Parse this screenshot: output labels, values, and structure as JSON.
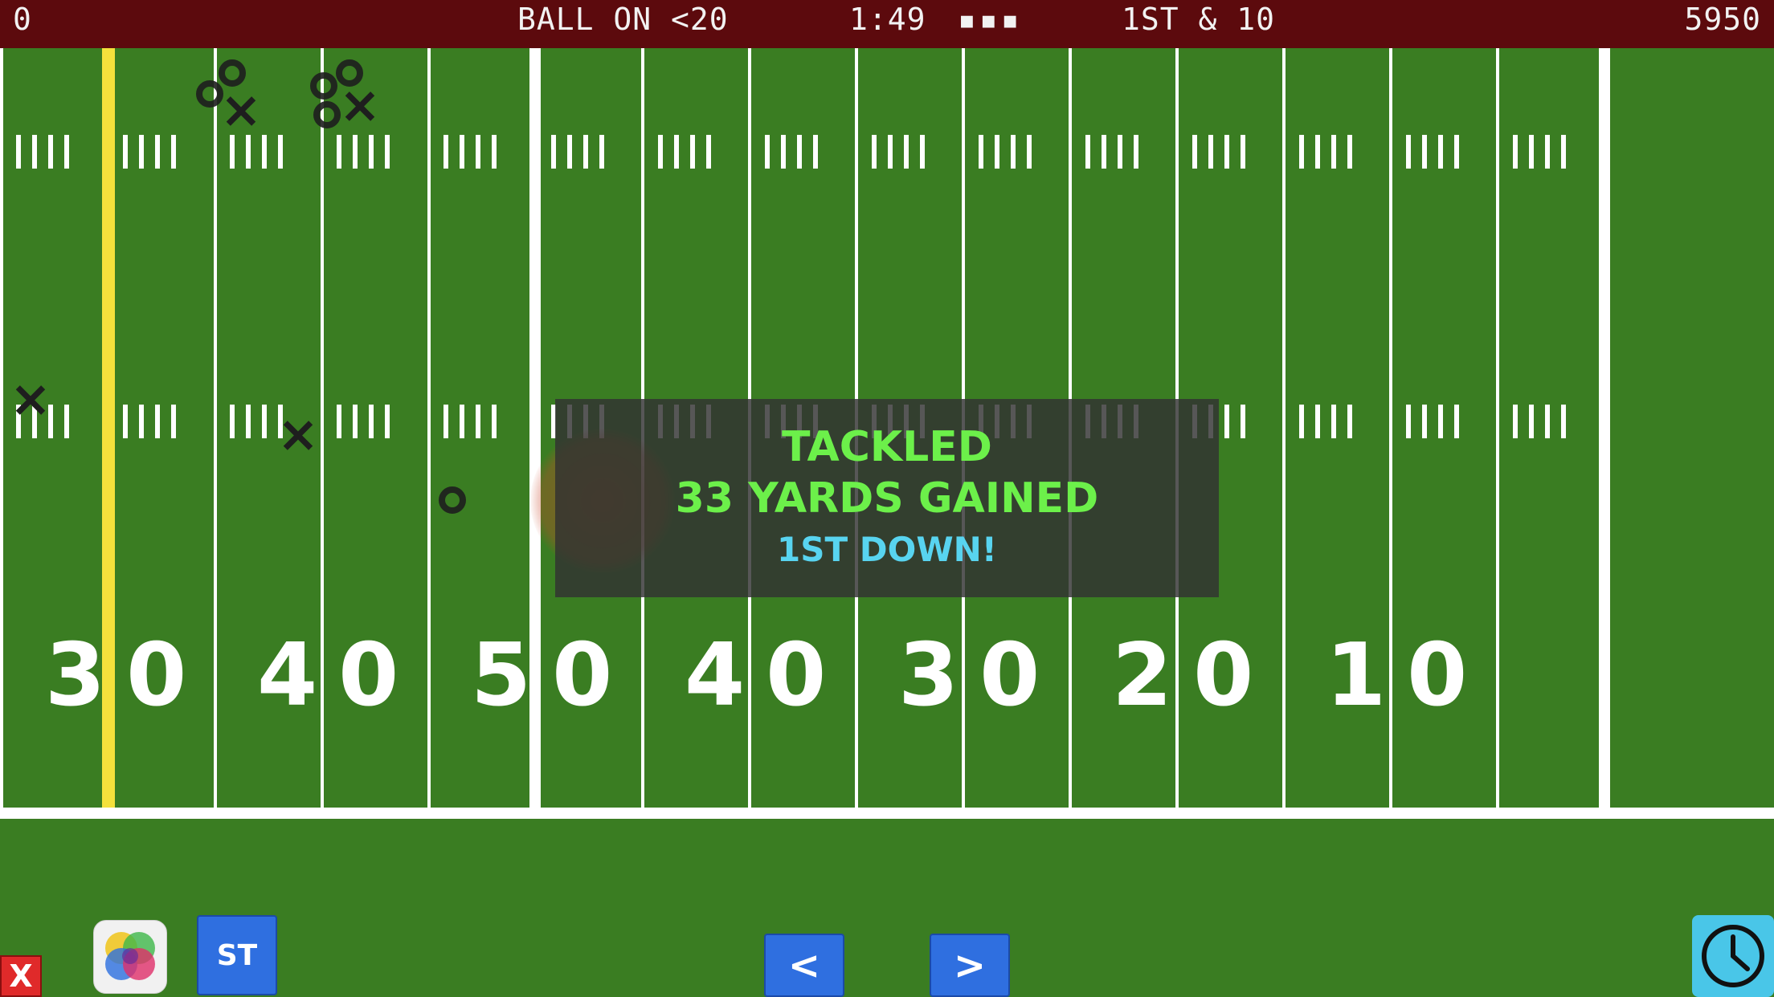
{
  "scoreboard": {
    "home_score": "0",
    "ball_on": "BALL ON <20",
    "clock": "1:49",
    "timeouts": "▪▪▪",
    "down_distance": "1ST & 10",
    "away_score": "5950"
  },
  "field": {
    "yard_numbers": [
      {
        "left": "3",
        "right": "0"
      },
      {
        "left": "4",
        "right": "0"
      },
      {
        "left": "5",
        "right": "0"
      },
      {
        "left": "4",
        "right": "0"
      },
      {
        "left": "3",
        "right": "0"
      },
      {
        "left": "2",
        "right": "0"
      },
      {
        "left": "1",
        "right": "0"
      }
    ]
  },
  "popup": {
    "line1": "TACKLED",
    "line2": "33 YARDS GAINED",
    "line3": "1ST DOWN!"
  },
  "controls": {
    "quit_label": "X",
    "special_teams_label": "ST",
    "left_label": "<",
    "right_label": ">"
  },
  "colors": {
    "turf": "#3a7d22",
    "scoreboard": "#5c0a0d",
    "line_of_scrimmage": "#f4e13c",
    "button_blue": "#2f6fe0",
    "popup_green": "#6cf04a",
    "popup_cyan": "#58d4f0",
    "clock_button": "#49c6e8"
  },
  "icons": {
    "color_picker": "color-wheel-icon",
    "clock": "clock-icon"
  }
}
